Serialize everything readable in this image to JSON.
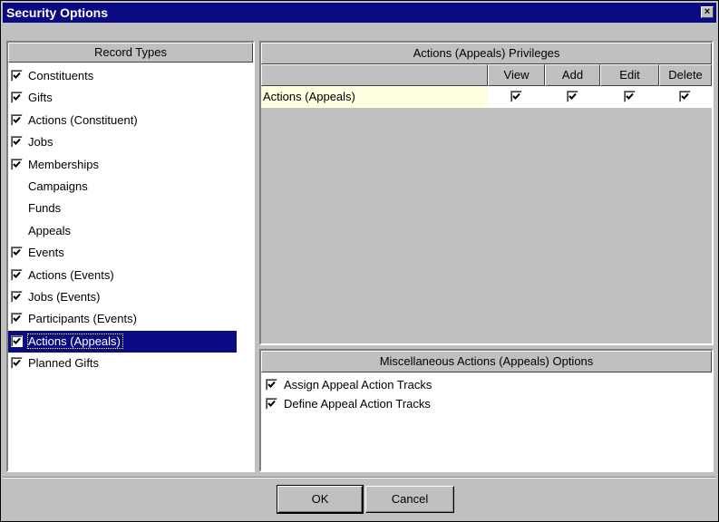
{
  "window": {
    "title": "Security Options",
    "close_glyph": "×"
  },
  "record_types": {
    "header": "Record Types",
    "items": [
      {
        "label": "Constituents",
        "checked": true
      },
      {
        "label": "Gifts",
        "checked": true
      },
      {
        "label": "Actions (Constituent)",
        "checked": true
      },
      {
        "label": "Jobs",
        "checked": true
      },
      {
        "label": "Memberships",
        "checked": true
      },
      {
        "label": "Campaigns",
        "checked": false
      },
      {
        "label": "Funds",
        "checked": false
      },
      {
        "label": "Appeals",
        "checked": false
      },
      {
        "label": "Events",
        "checked": true
      },
      {
        "label": "Actions (Events)",
        "checked": true
      },
      {
        "label": "Jobs (Events)",
        "checked": true
      },
      {
        "label": "Participants (Events)",
        "checked": true
      },
      {
        "label": "Actions (Appeals)",
        "checked": true,
        "selected": true
      },
      {
        "label": "Planned Gifts",
        "checked": true
      }
    ]
  },
  "privileges": {
    "header": "Actions (Appeals) Privileges",
    "columns": [
      "View",
      "Add",
      "Edit",
      "Delete"
    ],
    "rows": [
      {
        "label": "Actions (Appeals)",
        "view": true,
        "add": true,
        "edit": true,
        "delete": true
      }
    ]
  },
  "misc": {
    "header": "Miscellaneous Actions (Appeals) Options",
    "items": [
      {
        "label": "Assign Appeal Action Tracks",
        "checked": true
      },
      {
        "label": "Define Appeal Action Tracks",
        "checked": true
      }
    ]
  },
  "buttons": {
    "ok": "OK",
    "cancel": "Cancel"
  },
  "colors": {
    "title_bar": "#0a0a84",
    "selection": "#0a0a84",
    "row_highlight": "#ffffe1",
    "face": "#c0c0c0"
  }
}
